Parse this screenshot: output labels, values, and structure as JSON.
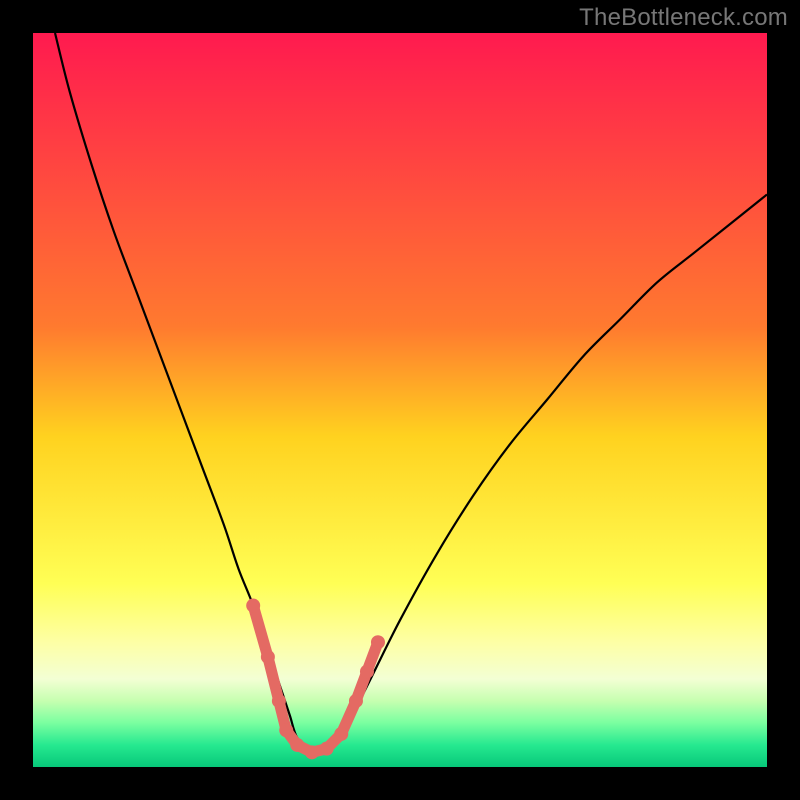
{
  "watermark": "TheBottleneck.com",
  "chart_data": {
    "type": "line",
    "title": "",
    "xlabel": "",
    "ylabel": "",
    "xlim": [
      0,
      100
    ],
    "ylim": [
      0,
      100
    ],
    "background_gradient": {
      "stops": [
        {
          "offset": 0,
          "color": "#ff1a4f"
        },
        {
          "offset": 40,
          "color": "#ff7a2f"
        },
        {
          "offset": 55,
          "color": "#ffd21f"
        },
        {
          "offset": 75,
          "color": "#ffff55"
        },
        {
          "offset": 83,
          "color": "#fdffa5"
        },
        {
          "offset": 88,
          "color": "#f3ffd4"
        },
        {
          "offset": 91,
          "color": "#c6ffb0"
        },
        {
          "offset": 94,
          "color": "#7affa0"
        },
        {
          "offset": 97,
          "color": "#26e990"
        },
        {
          "offset": 100,
          "color": "#07c87a"
        }
      ]
    },
    "series": [
      {
        "name": "bottleneck-curve",
        "color": "#000000",
        "x": [
          3,
          5,
          8,
          11,
          14,
          17,
          20,
          23,
          26,
          28,
          30,
          32,
          34,
          35,
          36,
          38,
          40,
          42,
          44,
          46,
          50,
          55,
          60,
          65,
          70,
          75,
          80,
          85,
          90,
          95,
          100
        ],
        "y": [
          100,
          92,
          82,
          73,
          65,
          57,
          49,
          41,
          33,
          27,
          22,
          16,
          10,
          7,
          4,
          2,
          2,
          4,
          8,
          12,
          20,
          29,
          37,
          44,
          50,
          56,
          61,
          66,
          70,
          74,
          78
        ]
      }
    ],
    "markers": {
      "name": "highlight-points",
      "color": "#e46a63",
      "radius": 7,
      "points": [
        {
          "x": 30,
          "y": 22
        },
        {
          "x": 32,
          "y": 15
        },
        {
          "x": 33.5,
          "y": 9
        },
        {
          "x": 34.5,
          "y": 5
        },
        {
          "x": 36,
          "y": 3
        },
        {
          "x": 38,
          "y": 2
        },
        {
          "x": 40,
          "y": 2.5
        },
        {
          "x": 42,
          "y": 4.5
        },
        {
          "x": 44,
          "y": 9
        },
        {
          "x": 45.5,
          "y": 13
        },
        {
          "x": 47,
          "y": 17
        }
      ]
    }
  }
}
